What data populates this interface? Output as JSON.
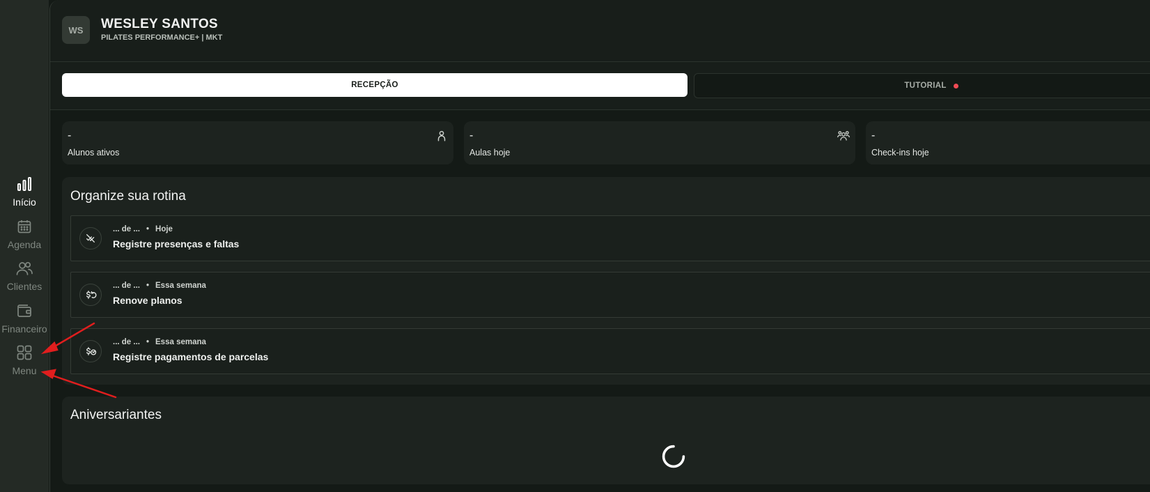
{
  "sidebar": {
    "items": [
      {
        "label": "Início",
        "icon": "bar-chart-icon",
        "active": true
      },
      {
        "label": "Agenda",
        "icon": "calendar-icon",
        "active": false
      },
      {
        "label": "Clientes",
        "icon": "users-icon",
        "active": false
      },
      {
        "label": "Financeiro",
        "icon": "wallet-icon",
        "active": false
      },
      {
        "label": "Menu",
        "icon": "grid-icon",
        "active": false
      }
    ]
  },
  "header": {
    "avatar_initials": "WS",
    "user_name": "WESLEY SANTOS",
    "subtitle": "PILATES PERFORMANCE+ | MKT"
  },
  "tabs": {
    "reception": "RECEPÇÃO",
    "tutorial": "TUTORIAL"
  },
  "stats": [
    {
      "value": "-",
      "label": "Alunos ativos",
      "icon": "person-icon"
    },
    {
      "value": "-",
      "label": "Aulas hoje",
      "icon": "group-icon"
    },
    {
      "value": "-",
      "label": "Check-ins hoje",
      "icon": "check-in-icon"
    }
  ],
  "routine": {
    "title": "Organize sua rotina",
    "tasks": [
      {
        "progress": "... de ...",
        "period": "Hoje",
        "title": "Registre presenças e faltas",
        "icon": "attendance-icon"
      },
      {
        "progress": "... de ...",
        "period": "Essa semana",
        "title": "Renove planos",
        "icon": "renew-plan-icon"
      },
      {
        "progress": "... de ...",
        "period": "Essa semana",
        "title": "Registre pagamentos de parcelas",
        "icon": "payment-icon"
      }
    ]
  },
  "birthdays": {
    "title": "Aniversariantes"
  },
  "colors": {
    "accent_dot": "#ef4b55",
    "annotation_arrow": "#e01e1e"
  }
}
